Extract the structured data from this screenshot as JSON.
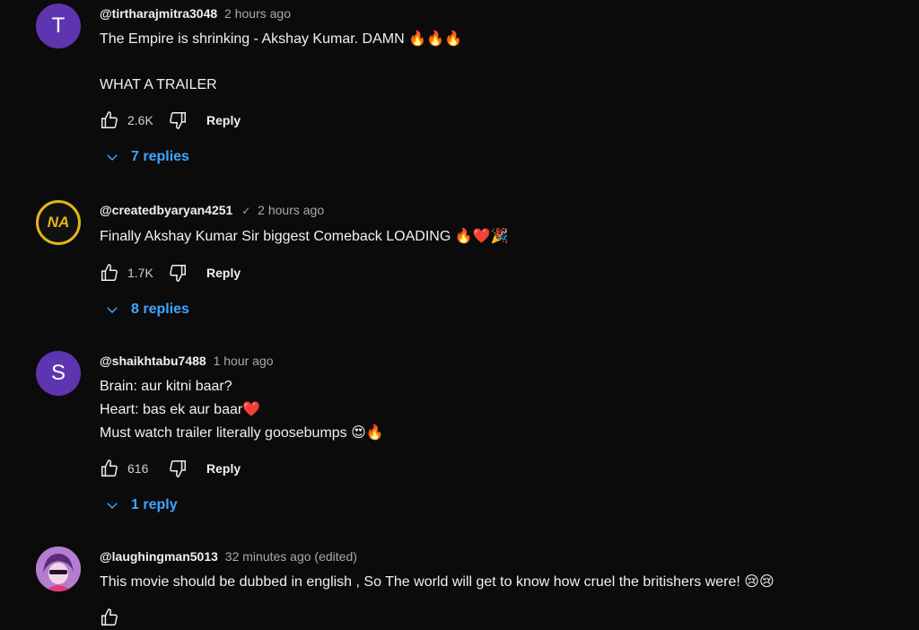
{
  "comments": [
    {
      "avatar_letter": "T",
      "handle": "@tirtharajmitra3048",
      "time": "2 hours ago",
      "lines": [
        "The Empire is shrinking - Akshay Kumar. DAMN 🔥🔥🔥",
        "",
        "WHAT A TRAILER"
      ],
      "likes": "2.6K",
      "reply_label": "Reply",
      "replies_label": "7 replies"
    },
    {
      "avatar_letter": "NA",
      "handle": "@createdbyaryan4251",
      "verified_icon": "check-icon",
      "time": "2 hours ago",
      "lines": [
        "Finally Akshay Kumar Sir biggest Comeback LOADING 🔥❤️🎉"
      ],
      "likes": "1.7K",
      "reply_label": "Reply",
      "replies_label": "8 replies"
    },
    {
      "avatar_letter": "S",
      "handle": "@shaikhtabu7488",
      "time": "1 hour ago",
      "lines": [
        "Brain: aur kitni baar?",
        "Heart: bas ek aur baar❤️",
        "Must watch trailer literally goosebumps 😍🔥"
      ],
      "likes": "616",
      "reply_label": "Reply",
      "replies_label": "1 reply"
    },
    {
      "handle": "@laughingman5013",
      "time": "32 minutes ago (edited)",
      "lines": [
        "This movie should be dubbed in english , So The world will get to know how cruel the britishers were! 😢😢"
      ]
    }
  ],
  "icons": {
    "like": "thumbs-up-icon",
    "dislike": "thumbs-down-icon",
    "expand": "chevron-down-icon"
  },
  "colors": {
    "background": "#0b0b0b",
    "link": "#3ea6ff",
    "avatar_purple": "#5e35b1",
    "na_gold": "#e4b514"
  }
}
